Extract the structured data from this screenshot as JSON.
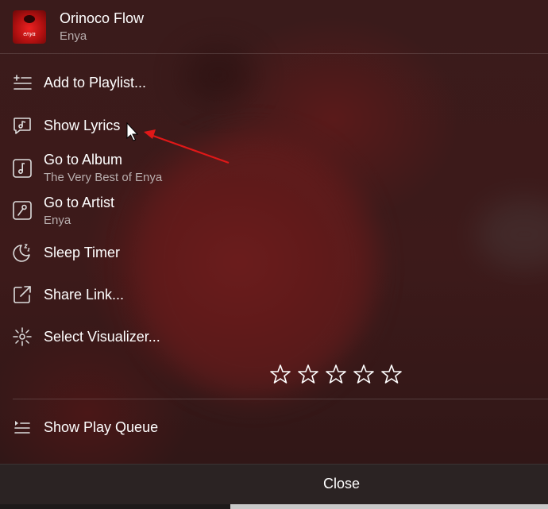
{
  "track": {
    "title": "Orinoco Flow",
    "artist": "Enya",
    "artwork_text": "enya"
  },
  "menu": {
    "add_to_playlist": "Add to Playlist...",
    "show_lyrics": "Show Lyrics",
    "go_to_album": "Go to Album",
    "album_name": "The Very Best of Enya",
    "go_to_artist": "Go to Artist",
    "artist_name": "Enya",
    "sleep_timer": "Sleep Timer",
    "share_link": "Share Link...",
    "select_visualizer": "Select Visualizer...",
    "show_play_queue": "Show Play Queue"
  },
  "rating": {
    "stars_filled": 0,
    "stars_total": 5
  },
  "footer": {
    "close_label": "Close"
  },
  "colors": {
    "background": "#3a1b1b",
    "annotation_arrow": "#e01818",
    "secondary_text": "#b8aeae"
  }
}
